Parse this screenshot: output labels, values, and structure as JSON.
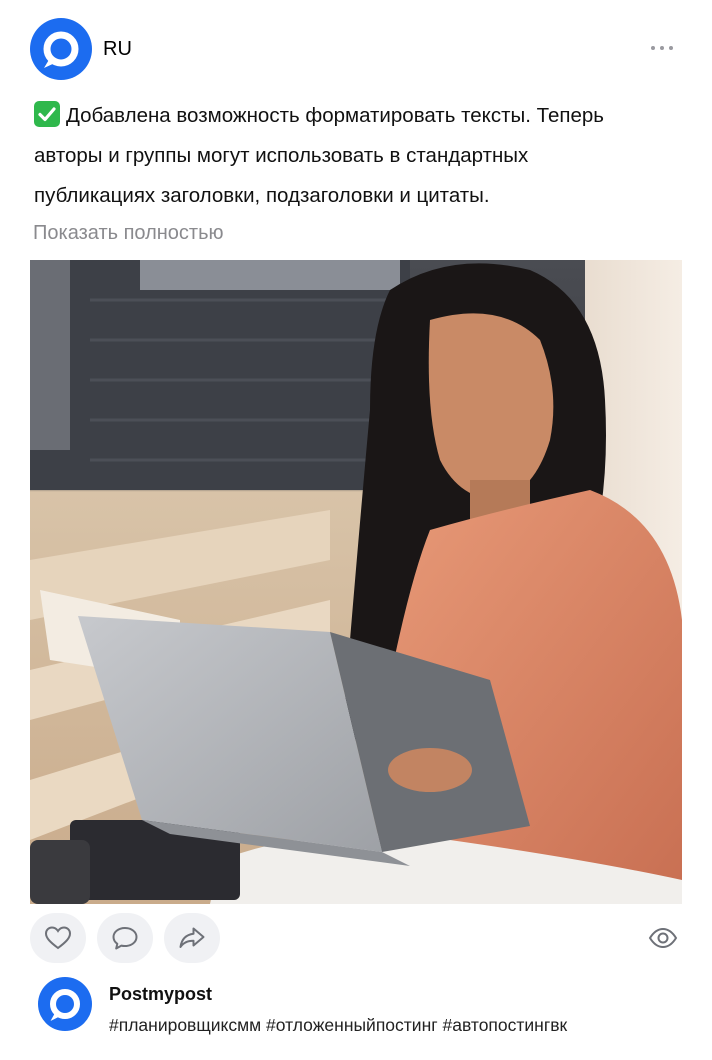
{
  "header": {
    "group_name": "RU",
    "avatar_icon": "postmypost-logo-icon",
    "more_icon": "more-horizontal-icon"
  },
  "post": {
    "text_lines": [
      "Добавлена возможность форматировать тексты. Теперь",
      "авторы и группы могут использовать в стандартных",
      "публикациях заголовки, подзаголовки и цитаты."
    ],
    "leading_icon": "check-mark-icon",
    "show_more_label": "Показать полностью"
  },
  "photo": {
    "subject_icon": "woman-with-laptop-photo"
  },
  "actions": {
    "like_icon": "heart-icon",
    "comment_icon": "comment-icon",
    "share_icon": "share-icon",
    "views_icon": "eye-icon"
  },
  "footer": {
    "author_name": "Postmypost",
    "hashtags": "#планировщиксмм #отложенныйпостинг #автопостингвк"
  },
  "colors": {
    "brand_blue": "#1c6cf0",
    "check_green": "#2fb84c",
    "muted_text": "#8a8a8e",
    "button_bg": "#f0f1f4"
  }
}
